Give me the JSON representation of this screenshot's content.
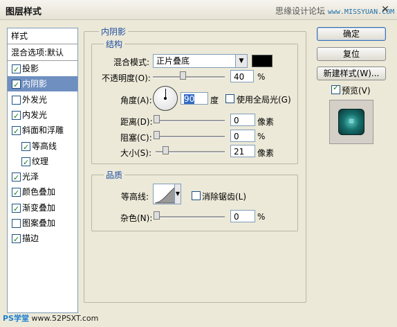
{
  "title": "图层样式",
  "watermark_top": {
    "label": "思缘设计论坛",
    "url": "www.MISSYUAN.COM"
  },
  "left_panel": {
    "header": "样式",
    "blend_default": "混合选项:默认",
    "items": [
      {
        "label": "投影",
        "checked": true,
        "selected": false,
        "indent": false
      },
      {
        "label": "内阴影",
        "checked": true,
        "selected": true,
        "indent": false
      },
      {
        "label": "外发光",
        "checked": false,
        "selected": false,
        "indent": false
      },
      {
        "label": "内发光",
        "checked": true,
        "selected": false,
        "indent": false
      },
      {
        "label": "斜面和浮雕",
        "checked": true,
        "selected": false,
        "indent": false
      },
      {
        "label": "等高线",
        "checked": true,
        "selected": false,
        "indent": true
      },
      {
        "label": "纹理",
        "checked": true,
        "selected": false,
        "indent": true
      },
      {
        "label": "光泽",
        "checked": true,
        "selected": false,
        "indent": false
      },
      {
        "label": "颜色叠加",
        "checked": true,
        "selected": false,
        "indent": false
      },
      {
        "label": "渐变叠加",
        "checked": true,
        "selected": false,
        "indent": false
      },
      {
        "label": "图案叠加",
        "checked": false,
        "selected": false,
        "indent": false
      },
      {
        "label": "描边",
        "checked": true,
        "selected": false,
        "indent": false
      }
    ]
  },
  "inner_shadow": {
    "group_title": "内阴影",
    "structure": {
      "title": "结构",
      "blend_mode_label": "混合模式:",
      "blend_mode_value": "正片叠底",
      "shadow_color": "#000000",
      "opacity_label": "不透明度(O):",
      "opacity_value": "40",
      "opacity_unit": "%",
      "angle_label": "角度(A):",
      "angle_value": "90",
      "angle_unit": "度",
      "global_light_label": "使用全局光(G)",
      "global_light_checked": false,
      "distance_label": "距离(D):",
      "distance_value": "0",
      "distance_unit": "像素",
      "choke_label": "阻塞(C):",
      "choke_value": "0",
      "choke_unit": "%",
      "size_label": "大小(S):",
      "size_value": "21",
      "size_unit": "像素"
    },
    "quality": {
      "title": "品质",
      "contour_label": "等高线:",
      "antialias_label": "消除锯齿(L)",
      "antialias_checked": false,
      "noise_label": "杂色(N):",
      "noise_value": "0",
      "noise_unit": "%"
    }
  },
  "buttons": {
    "ok": "确定",
    "reset": "复位",
    "new_style": "新建样式(W)...",
    "preview_label": "预览(V)",
    "preview_checked": true
  },
  "watermark_bottom": {
    "ps": "PS学堂",
    "url": "www.52PSXT.com"
  },
  "colors": {
    "selection": "#6f8fc0",
    "group_title": "#1d4da0",
    "dialog_bg": "#ece9d8"
  }
}
